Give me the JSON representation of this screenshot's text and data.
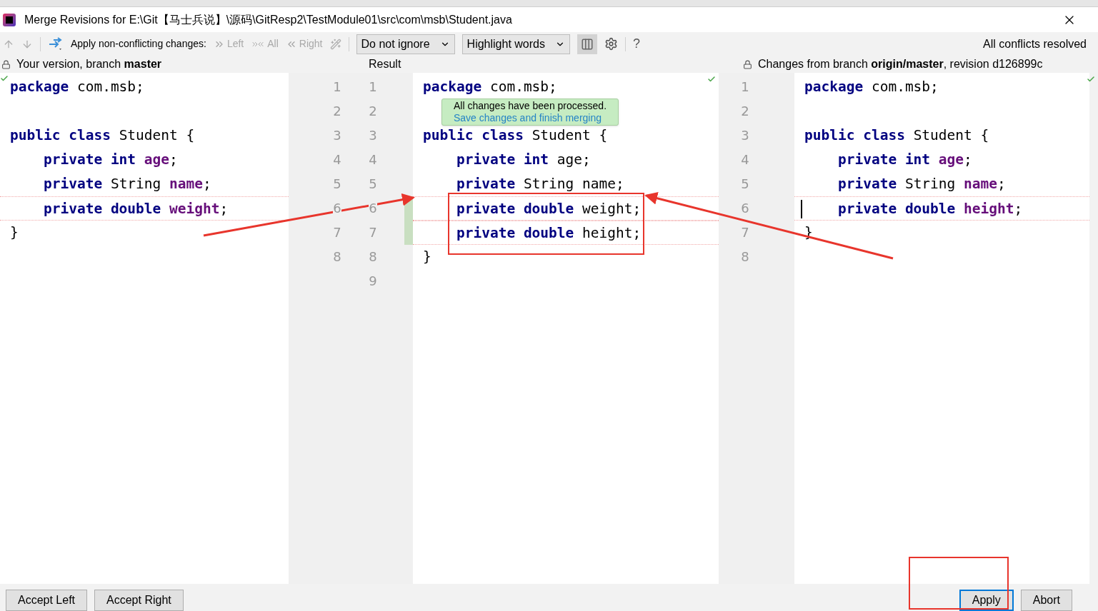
{
  "window": {
    "title": "Merge Revisions for E:\\Git【马士兵说】\\源码\\GitResp2\\TestModule01\\src\\com\\msb\\Student.java"
  },
  "toolbar": {
    "apply_label": "Apply non-conflicting changes:",
    "actions": [
      {
        "kind": "left",
        "label": "Left",
        "disabled": true
      },
      {
        "kind": "all",
        "label": "All",
        "disabled": true
      },
      {
        "kind": "right",
        "label": "Right",
        "disabled": true
      }
    ],
    "ignore_dropdown": "Do not ignore",
    "highlight_dropdown": "Highlight words",
    "layout_toggle_selected": true,
    "help_label": "?",
    "status": "All conflicts resolved"
  },
  "headers": {
    "left": "Your version, branch **master**",
    "result": "Result",
    "right": "Changes from branch **origin/master**, revision d126899c"
  },
  "left_pane": {
    "lines": [
      {
        "changed": false,
        "tokens": [
          {
            "text": "package ",
            "kind": "kw"
          },
          {
            "text": "com.msb;",
            "kind": "plain"
          }
        ]
      },
      {
        "changed": false
      },
      {
        "changed": false,
        "tokens": [
          {
            "text": "public class ",
            "kind": "kw"
          },
          {
            "text": "Student {",
            "kind": "plain"
          }
        ]
      },
      {
        "changed": false,
        "tokens": [
          {
            "text": "    private int ",
            "kind": "kw"
          },
          {
            "text": "age",
            "kind": "field"
          },
          {
            "text": ";",
            "kind": "plain"
          }
        ]
      },
      {
        "changed": false,
        "tokens": [
          {
            "text": "    private ",
            "kind": "kw"
          },
          {
            "text": "String ",
            "kind": "plain"
          },
          {
            "text": "name",
            "kind": "field"
          },
          {
            "text": ";",
            "kind": "plain"
          }
        ]
      },
      {
        "changed": true,
        "tokens": [
          {
            "text": "    private double ",
            "kind": "kw"
          },
          {
            "text": "weight",
            "kind": "field"
          },
          {
            "text": ";",
            "kind": "plain"
          }
        ]
      },
      {
        "changed": false,
        "tokens": [
          {
            "text": "}",
            "kind": "plain"
          }
        ]
      }
    ]
  },
  "left_numbers": [
    "1",
    "2",
    "3",
    "4",
    "5",
    "6",
    "7",
    "8"
  ],
  "result_numbers": [
    "1",
    "2",
    "3",
    "4",
    "5",
    "6",
    "7",
    "8",
    "9"
  ],
  "result_pane": {
    "lines": [
      {
        "changed": false,
        "tokens": [
          {
            "text": "package ",
            "kind": "kw"
          },
          {
            "text": "com.msb;",
            "kind": "plain"
          }
        ]
      },
      {
        "changed": false
      },
      {
        "changed": false,
        "tokens": [
          {
            "text": "public class ",
            "kind": "kw"
          },
          {
            "text": "Student {",
            "kind": "plain"
          }
        ]
      },
      {
        "changed": false,
        "tokens": [
          {
            "text": "    private int ",
            "kind": "kw"
          },
          {
            "text": "age;",
            "kind": "plain"
          }
        ]
      },
      {
        "changed": false,
        "tokens": [
          {
            "text": "    private ",
            "kind": "kw"
          },
          {
            "text": "String name;",
            "kind": "plain"
          }
        ]
      },
      {
        "changed": true,
        "tokens": [
          {
            "text": "    private double ",
            "kind": "kw"
          },
          {
            "text": "weight;",
            "kind": "plain"
          }
        ]
      },
      {
        "changed": true,
        "tokens": [
          {
            "text": "    private double ",
            "kind": "kw"
          },
          {
            "text": "height;",
            "kind": "plain"
          }
        ]
      },
      {
        "changed": false,
        "tokens": [
          {
            "text": "}",
            "kind": "plain"
          }
        ]
      }
    ]
  },
  "tooltip": {
    "message": "All changes have been processed.",
    "link": "Save changes and finish merging"
  },
  "right_numbers": [
    "1",
    "2",
    "3",
    "4",
    "5",
    "6",
    "7",
    "8"
  ],
  "right_pane": {
    "lines": [
      {
        "changed": false,
        "tokens": [
          {
            "text": "package ",
            "kind": "kw"
          },
          {
            "text": "com.msb;",
            "kind": "plain"
          }
        ]
      },
      {
        "changed": false
      },
      {
        "changed": false,
        "tokens": [
          {
            "text": "public class ",
            "kind": "kw"
          },
          {
            "text": "Student {",
            "kind": "plain"
          }
        ]
      },
      {
        "changed": false,
        "tokens": [
          {
            "text": "    private int ",
            "kind": "kw"
          },
          {
            "text": "age",
            "kind": "field"
          },
          {
            "text": ";",
            "kind": "plain"
          }
        ]
      },
      {
        "changed": false,
        "tokens": [
          {
            "text": "    private ",
            "kind": "kw"
          },
          {
            "text": "String ",
            "kind": "plain"
          },
          {
            "text": "name",
            "kind": "field"
          },
          {
            "text": ";",
            "kind": "plain"
          }
        ]
      },
      {
        "changed": true,
        "tokens": [
          {
            "text": "    private double ",
            "kind": "kw"
          },
          {
            "text": "height",
            "kind": "field"
          },
          {
            "text": ";",
            "kind": "plain"
          }
        ]
      },
      {
        "changed": false,
        "tokens": [
          {
            "text": "}",
            "kind": "plain"
          }
        ]
      }
    ]
  },
  "left_buttons": [
    {
      "label": "Accept Left",
      "default": false
    },
    {
      "label": "Accept Right",
      "default": false
    }
  ],
  "right_buttons": [
    {
      "label": "Apply",
      "default": true
    },
    {
      "label": "Abort",
      "default": false
    }
  ]
}
